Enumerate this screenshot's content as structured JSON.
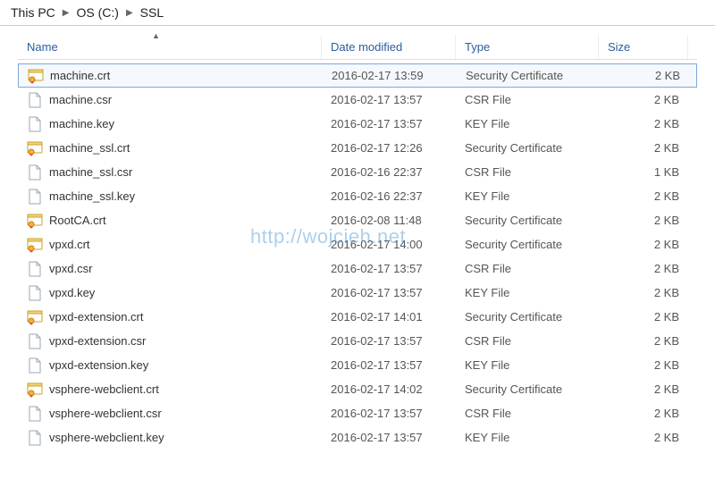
{
  "breadcrumb": {
    "items": [
      "This PC",
      "OS (C:)",
      "SSL"
    ]
  },
  "columns": {
    "name": "Name",
    "date": "Date modified",
    "type": "Type",
    "size": "Size"
  },
  "sort": {
    "column": "name",
    "direction": "asc",
    "indicator": "▲"
  },
  "watermark": "http://wojcieh.net",
  "files": [
    {
      "name": "machine.crt",
      "date": "2016-02-17 13:59",
      "type": "Security Certificate",
      "size": "2 KB",
      "icon": "cert",
      "selected": true
    },
    {
      "name": "machine.csr",
      "date": "2016-02-17 13:57",
      "type": "CSR File",
      "size": "2 KB",
      "icon": "file",
      "selected": false
    },
    {
      "name": "machine.key",
      "date": "2016-02-17 13:57",
      "type": "KEY File",
      "size": "2 KB",
      "icon": "file",
      "selected": false
    },
    {
      "name": "machine_ssl.crt",
      "date": "2016-02-17 12:26",
      "type": "Security Certificate",
      "size": "2 KB",
      "icon": "cert",
      "selected": false
    },
    {
      "name": "machine_ssl.csr",
      "date": "2016-02-16 22:37",
      "type": "CSR File",
      "size": "1 KB",
      "icon": "file",
      "selected": false
    },
    {
      "name": "machine_ssl.key",
      "date": "2016-02-16 22:37",
      "type": "KEY File",
      "size": "2 KB",
      "icon": "file",
      "selected": false
    },
    {
      "name": "RootCA.crt",
      "date": "2016-02-08 11:48",
      "type": "Security Certificate",
      "size": "2 KB",
      "icon": "cert",
      "selected": false
    },
    {
      "name": "vpxd.crt",
      "date": "2016-02-17 14:00",
      "type": "Security Certificate",
      "size": "2 KB",
      "icon": "cert",
      "selected": false
    },
    {
      "name": "vpxd.csr",
      "date": "2016-02-17 13:57",
      "type": "CSR File",
      "size": "2 KB",
      "icon": "file",
      "selected": false
    },
    {
      "name": "vpxd.key",
      "date": "2016-02-17 13:57",
      "type": "KEY File",
      "size": "2 KB",
      "icon": "file",
      "selected": false
    },
    {
      "name": "vpxd-extension.crt",
      "date": "2016-02-17 14:01",
      "type": "Security Certificate",
      "size": "2 KB",
      "icon": "cert",
      "selected": false
    },
    {
      "name": "vpxd-extension.csr",
      "date": "2016-02-17 13:57",
      "type": "CSR File",
      "size": "2 KB",
      "icon": "file",
      "selected": false
    },
    {
      "name": "vpxd-extension.key",
      "date": "2016-02-17 13:57",
      "type": "KEY File",
      "size": "2 KB",
      "icon": "file",
      "selected": false
    },
    {
      "name": "vsphere-webclient.crt",
      "date": "2016-02-17 14:02",
      "type": "Security Certificate",
      "size": "2 KB",
      "icon": "cert",
      "selected": false
    },
    {
      "name": "vsphere-webclient.csr",
      "date": "2016-02-17 13:57",
      "type": "CSR File",
      "size": "2 KB",
      "icon": "file",
      "selected": false
    },
    {
      "name": "vsphere-webclient.key",
      "date": "2016-02-17 13:57",
      "type": "KEY File",
      "size": "2 KB",
      "icon": "file",
      "selected": false
    }
  ]
}
